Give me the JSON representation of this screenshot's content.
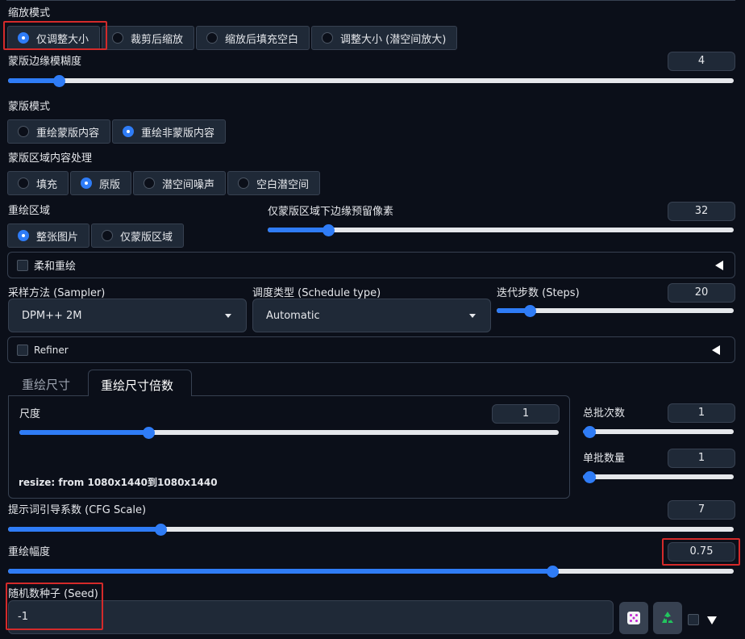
{
  "resize_mode": {
    "label": "缩放模式",
    "options": [
      "仅调整大小",
      "裁剪后缩放",
      "缩放后填充空白",
      "调整大小 (潜空间放大)"
    ],
    "selected_index": 0
  },
  "mask_blur": {
    "label": "蒙版边缘模糊度",
    "value": "4",
    "fraction": 0.07
  },
  "mask_mode": {
    "label": "蒙版模式",
    "options": [
      "重绘蒙版内容",
      "重绘非蒙版内容"
    ],
    "selected_index": 1
  },
  "masked_content": {
    "label": "蒙版区域内容处理",
    "options": [
      "填充",
      "原版",
      "潜空间噪声",
      "空白潜空间"
    ],
    "selected_index": 1
  },
  "inpaint_area": {
    "label": "重绘区域",
    "options": [
      "整张图片",
      "仅蒙版区域"
    ],
    "selected_index": 0
  },
  "only_masked_padding": {
    "label": "仅蒙版区域下边缘预留像素",
    "value": "32",
    "fraction": 0.13
  },
  "soft_inpainting": {
    "label": "柔和重绘"
  },
  "sampler": {
    "label": "采样方法 (Sampler)",
    "value": "DPM++ 2M"
  },
  "schedule_type": {
    "label": "调度类型 (Schedule type)",
    "value": "Automatic"
  },
  "steps": {
    "label": "迭代步数 (Steps)",
    "value": "20",
    "fraction": 0.14
  },
  "refiner": {
    "label": "Refiner"
  },
  "size_tabs": {
    "tabs": [
      "重绘尺寸",
      "重绘尺寸倍数"
    ],
    "active_index": 1
  },
  "scale": {
    "label": "尺度",
    "value": "1",
    "fraction": 0.24
  },
  "resize_info": {
    "text": "resize: from 1080x1440到1080x1440"
  },
  "batch_count": {
    "label": "总批次数",
    "value": "1",
    "fraction": 0.0
  },
  "batch_size": {
    "label": "单批数量",
    "value": "1",
    "fraction": 0.0
  },
  "cfg_scale": {
    "label": "提示词引导系数 (CFG Scale)",
    "value": "7",
    "fraction": 0.21
  },
  "denoising": {
    "label": "重绘幅度",
    "value": "0.75",
    "fraction": 0.75
  },
  "seed": {
    "label": "随机数种子 (Seed)",
    "value": "-1"
  },
  "icons": {
    "dice": "dice-icon",
    "recycle": "recycle-icon",
    "expand": "triangle-down-icon"
  },
  "colors": {
    "accent": "#2f7cf6",
    "highlight": "#d42a2a",
    "background": "#0b0f19",
    "input": "#1f2937"
  }
}
